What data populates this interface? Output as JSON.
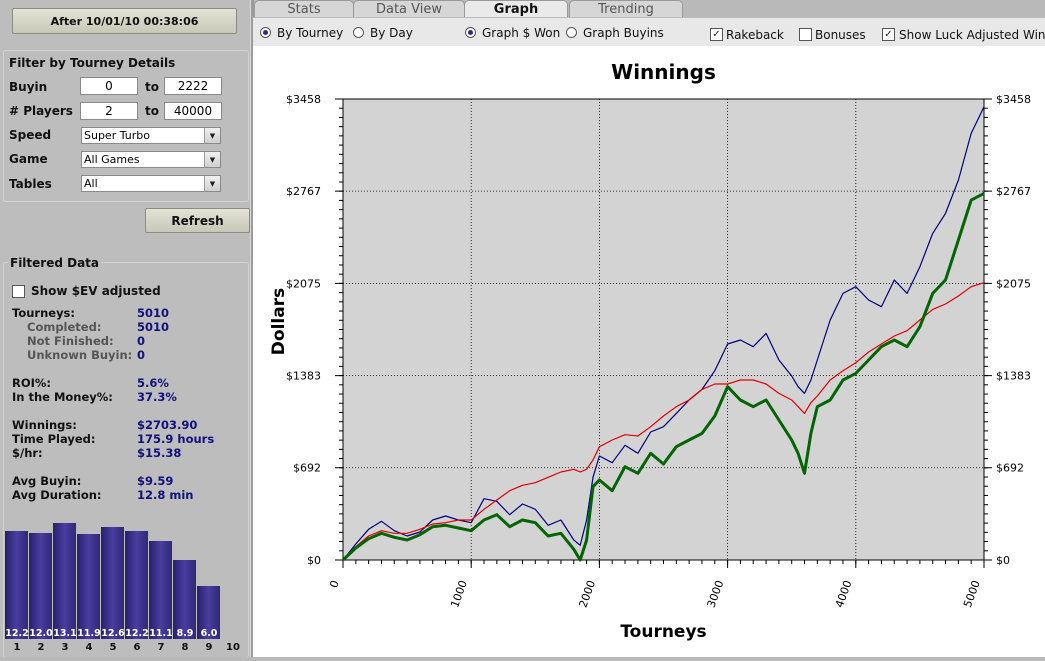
{
  "date_filter": {
    "label": "After 10/01/10 00:38:06"
  },
  "filter": {
    "title": "Filter by Tourney Details",
    "buyin": {
      "label": "Buyin",
      "min": "0",
      "to": "to",
      "max": "2222"
    },
    "players": {
      "label": "# Players",
      "min": "2",
      "to": "to",
      "max": "40000"
    },
    "speed": {
      "label": "Speed",
      "value": "Super Turbo"
    },
    "game": {
      "label": "Game",
      "value": "All Games"
    },
    "tables": {
      "label": "Tables",
      "value": "All"
    },
    "refresh": "Refresh"
  },
  "filtered": {
    "title": "Filtered Data",
    "ev_label": "Show $EV adjusted",
    "ev_checked": false,
    "stats": [
      {
        "label": "Tourneys:",
        "value": "5010",
        "sub": false
      },
      {
        "label": "Completed:",
        "value": "5010",
        "sub": true
      },
      {
        "label": "Not Finished:",
        "value": "0",
        "sub": true
      },
      {
        "label": "Unknown Buyin:",
        "value": "0",
        "sub": true
      },
      {
        "label": "ROI%:",
        "value": "5.6%",
        "sub": false
      },
      {
        "label": "In the Money%:",
        "value": "37.3%",
        "sub": false
      },
      {
        "label": "Winnings:",
        "value": "$2703.90",
        "sub": false
      },
      {
        "label": "Time Played:",
        "value": "175.9 hours",
        "sub": false
      },
      {
        "label": "$/hr:",
        "value": "$15.38",
        "sub": false
      },
      {
        "label": "Avg Buyin:",
        "value": "$9.59",
        "sub": false
      },
      {
        "label": "Avg Duration:",
        "value": "12.8 min",
        "sub": false
      }
    ]
  },
  "finish_bars": {
    "indices": [
      "1",
      "2",
      "3",
      "4",
      "5",
      "6",
      "7",
      "8",
      "9",
      "10"
    ],
    "values": [
      12.2,
      12.0,
      13.1,
      11.9,
      12.6,
      12.2,
      11.1,
      8.9,
      6.0,
      null
    ],
    "labels": [
      "12.2",
      "12.0",
      "13.1",
      "11.9",
      "12.6",
      "12.2",
      "11.1",
      "8.9",
      "6.0",
      ""
    ]
  },
  "tabs": [
    {
      "label": "Stats",
      "active": false
    },
    {
      "label": "Data View",
      "active": false
    },
    {
      "label": "Graph",
      "active": true
    },
    {
      "label": "Trending",
      "active": false
    }
  ],
  "toolbar": {
    "by_tourney": "By Tourney",
    "by_day": "By Day",
    "graph_won": "Graph $ Won",
    "graph_buyins": "Graph Buyins",
    "rakeback": "Rakeback",
    "bonuses": "Bonuses",
    "luck": "Show Luck Adjusted Winn",
    "check": "✓"
  },
  "colors": {
    "blue": "#000080",
    "red": "#e00000",
    "green": "#006400",
    "plot_bg": "#d3d3d3"
  },
  "chart_data": {
    "type": "line",
    "title": "Winnings",
    "xlabel": "Tourneys",
    "ylabel": "Dollars",
    "xlim": [
      0,
      5000
    ],
    "ylim": [
      0,
      3458
    ],
    "x_ticks": [
      0,
      1000,
      2000,
      3000,
      4000,
      5000
    ],
    "y_ticks": [
      0,
      692,
      1383,
      2075,
      2767,
      3458
    ],
    "y_tick_labels": [
      "$0",
      "$692",
      "$1383",
      "$2075",
      "$2767",
      "$3458"
    ],
    "grid": true,
    "x": [
      0,
      100,
      200,
      300,
      400,
      500,
      600,
      700,
      800,
      900,
      1000,
      1100,
      1200,
      1300,
      1400,
      1500,
      1600,
      1700,
      1800,
      1850,
      1900,
      1950,
      2000,
      2100,
      2200,
      2300,
      2400,
      2500,
      2600,
      2700,
      2800,
      2900,
      3000,
      3100,
      3200,
      3300,
      3400,
      3500,
      3550,
      3600,
      3650,
      3700,
      3800,
      3900,
      4000,
      4100,
      4200,
      4300,
      4400,
      4500,
      4600,
      4700,
      4800,
      4900,
      5000
    ],
    "series": [
      {
        "values": [
          0,
          120,
          230,
          290,
          220,
          180,
          210,
          300,
          330,
          300,
          280,
          460,
          440,
          340,
          420,
          380,
          260,
          300,
          150,
          110,
          300,
          620,
          780,
          730,
          860,
          800,
          960,
          1000,
          1100,
          1200,
          1280,
          1420,
          1620,
          1650,
          1600,
          1700,
          1500,
          1380,
          1300,
          1250,
          1350,
          1500,
          1800,
          2000,
          2050,
          1950,
          1900,
          2100,
          2000,
          2200,
          2450,
          2600,
          2850,
          3200,
          3400
        ]
      },
      {
        "values": [
          0,
          100,
          180,
          220,
          200,
          200,
          230,
          270,
          280,
          300,
          300,
          380,
          450,
          520,
          560,
          580,
          620,
          660,
          680,
          660,
          680,
          750,
          850,
          900,
          940,
          930,
          1000,
          1080,
          1150,
          1200,
          1280,
          1320,
          1320,
          1350,
          1350,
          1320,
          1250,
          1200,
          1150,
          1100,
          1180,
          1230,
          1350,
          1420,
          1480,
          1560,
          1620,
          1680,
          1720,
          1800,
          1880,
          1920,
          1980,
          2050,
          2080
        ]
      },
      {
        "values": [
          0,
          90,
          160,
          200,
          170,
          150,
          190,
          250,
          260,
          240,
          220,
          300,
          340,
          250,
          300,
          280,
          180,
          200,
          80,
          0,
          150,
          550,
          600,
          520,
          700,
          650,
          800,
          720,
          850,
          900,
          950,
          1080,
          1300,
          1200,
          1150,
          1200,
          1050,
          900,
          800,
          650,
          950,
          1150,
          1200,
          1350,
          1400,
          1500,
          1600,
          1650,
          1600,
          1750,
          2000,
          2100,
          2400,
          2700,
          2750
        ]
      }
    ]
  }
}
